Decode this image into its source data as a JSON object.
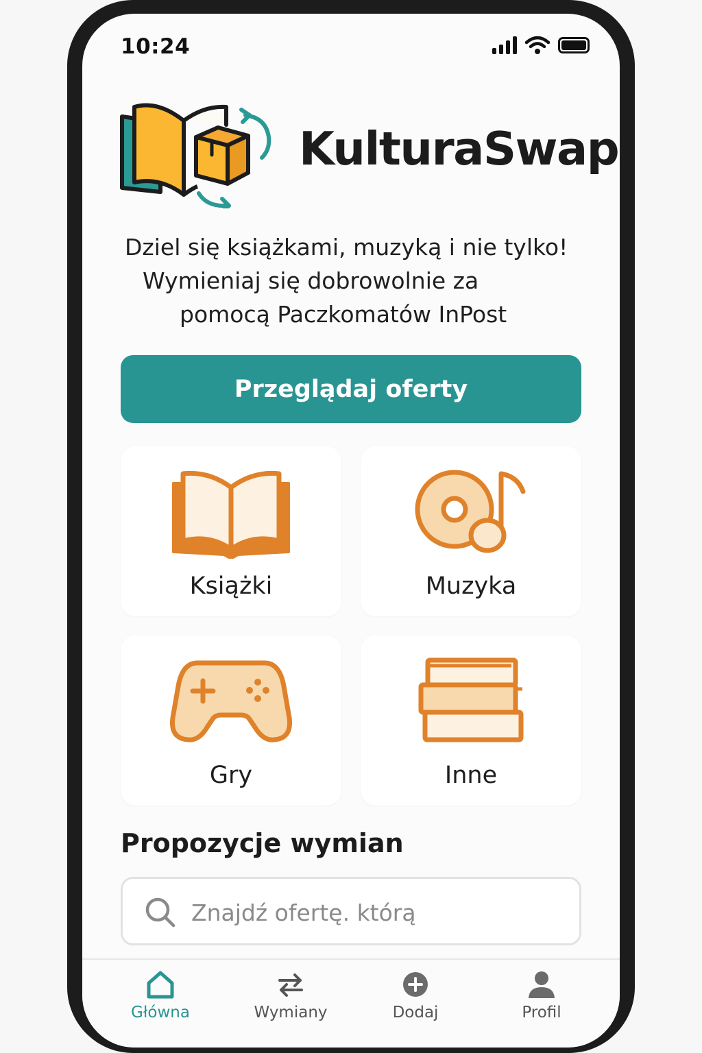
{
  "status_bar": {
    "time": "10:24"
  },
  "header": {
    "app_title": "KulturaSwap"
  },
  "tagline": {
    "line1": "Dziel się książkami, muzyką i nie tylko!",
    "line2": "Wymieniaj się dobrowolnie za",
    "line3": "pomocą Paczkomatów InPost"
  },
  "cta": {
    "label": "Przeglądaj oferty"
  },
  "categories": [
    {
      "label": "Książki",
      "icon": "open-book-icon"
    },
    {
      "label": "Muzyka",
      "icon": "music-disc-icon"
    },
    {
      "label": "Gry",
      "icon": "gamepad-icon"
    },
    {
      "label": "Inne",
      "icon": "book-stack-icon"
    }
  ],
  "section": {
    "title": "Propozycje wymian"
  },
  "search": {
    "placeholder": "Znajdź ofertę. którą",
    "value": ""
  },
  "nav": {
    "items": [
      {
        "label": "Główna",
        "icon": "home-icon",
        "active": true
      },
      {
        "label": "Wymiany",
        "icon": "swap-arrows-icon",
        "active": false
      },
      {
        "label": "Dodaj",
        "icon": "add-circle-icon",
        "active": false
      },
      {
        "label": "Profil",
        "icon": "person-icon",
        "active": false
      }
    ]
  },
  "colors": {
    "accent": "#289593",
    "category_icon": "#E0822A",
    "category_fill": "#F8D9AE",
    "logo_yellow": "#FBB731",
    "frame": "#1C1C1C"
  }
}
